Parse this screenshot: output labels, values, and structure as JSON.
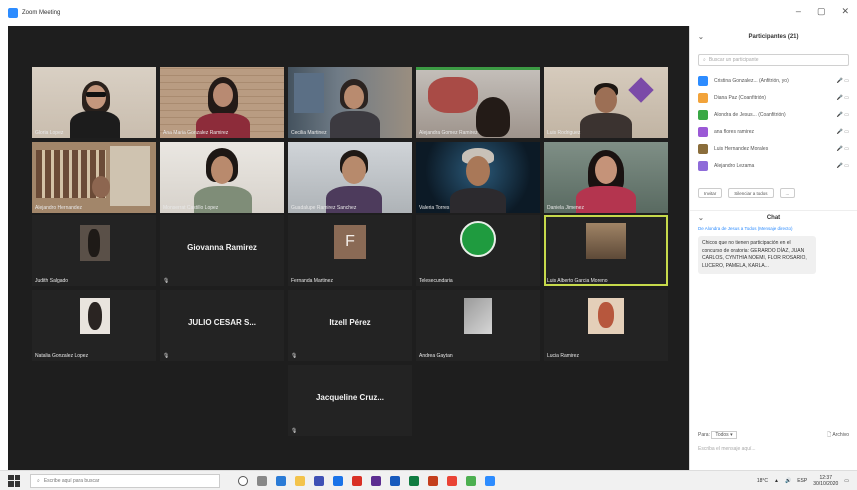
{
  "window": {
    "title": "Zoom Meeting",
    "min": "–",
    "max": "▢",
    "close": "✕"
  },
  "tiles": [
    {
      "caption": "Gloria Lopez"
    },
    {
      "caption": "Ana Maria Gonzalez Ramirez"
    },
    {
      "caption": "Cecilia Martinez"
    },
    {
      "caption": "Alejandra Gomez Ramirez"
    },
    {
      "caption": "Luis Rodriguez"
    },
    {
      "caption": "Alejandro Hernandez"
    },
    {
      "caption": "Monserrat Castillo Lopez"
    },
    {
      "caption": "Guadalupe Ramirez Sanchez"
    },
    {
      "caption": "Valeria Torres"
    },
    {
      "caption": "Daniela Jimenez"
    },
    {
      "caption": "Judith Salgado"
    },
    {
      "caption": "",
      "name": "Giovanna Ramirez"
    },
    {
      "caption": "Fernanda Martinez",
      "initial": "F"
    },
    {
      "caption": "Telesecundaria"
    },
    {
      "caption": "Luis Alberto Garcia Moreno"
    },
    {
      "caption": "Natalia Gonzalez Lopez"
    },
    {
      "caption": "",
      "name": "JULIO CESAR S..."
    },
    {
      "caption": "",
      "name": "Itzell Pérez"
    },
    {
      "caption": "Andrea Gaytan"
    },
    {
      "caption": "Lucia Ramirez"
    },
    {
      "caption": "",
      "name": "Jacqueline Cruz..."
    }
  ],
  "panel": {
    "participants_title": "Participantes (21)",
    "search_placeholder": "Buscar un participante",
    "participants": [
      {
        "name": "Cristina Gonzalez... (Anfitrión, yo)",
        "color": "#2d8cff"
      },
      {
        "name": "Diana Paz (Coanfitrión)",
        "color": "#f2a33a"
      },
      {
        "name": "Alondra de Jesus... (Coanfitrión)",
        "color": "#3aa845"
      },
      {
        "name": "ana flores ramirez",
        "color": "#9b59d6"
      },
      {
        "name": "Luis Hernandez Morales",
        "color": "#8a6d3b"
      },
      {
        "name": "Alejandro Lezama",
        "color": "#8e6bd9"
      }
    ],
    "invite_label": "Invitar",
    "mute_all_label": "Silenciar a todos",
    "more_label": "...",
    "chat_title": "Chat",
    "chat_from": "De Alondra de Jesus a Todos (Mensaje directo)",
    "chat_message": "Chicos que no tienen participación en el concurso de oratoria: GERARDO DÍAZ, JUAN CARLOS, CYNTHIA NOEMI, FLOR ROSARIO, LUCERO, PAMELA, KARLA...",
    "to_label": "Para:",
    "to_value": "Todos ▾",
    "file_label": "Archivo",
    "input_placeholder": "Escriba el mensaje aquí..."
  },
  "taskbar": {
    "search_placeholder": "Escribe aquí para buscar",
    "temp": "18°C",
    "lang": "ESP",
    "time": "12:37",
    "date": "30/10/2020"
  }
}
